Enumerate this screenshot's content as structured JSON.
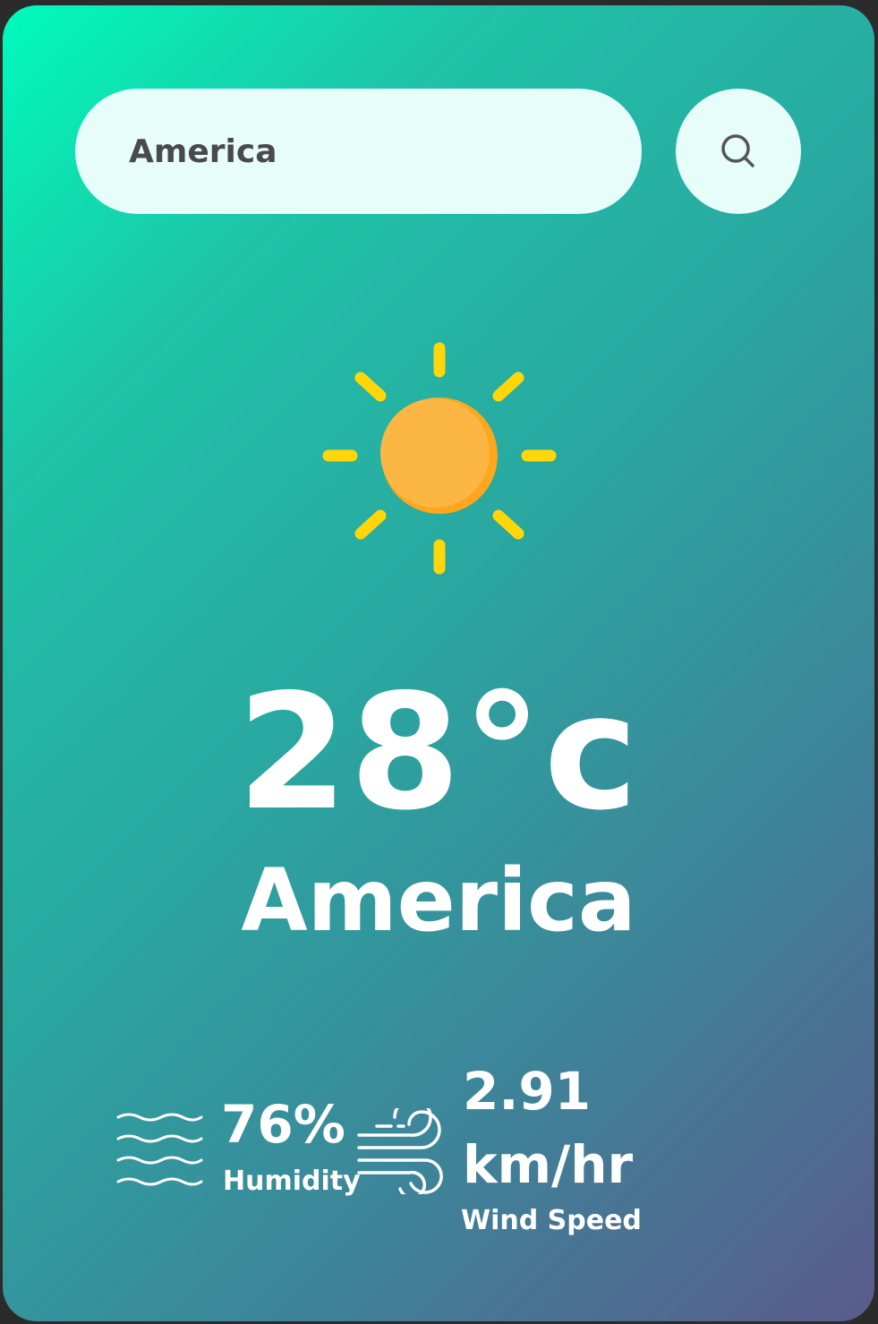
{
  "search": {
    "value": "America",
    "button_icon": "search-icon"
  },
  "weather": {
    "icon": "sun-icon",
    "temperature": "28°c",
    "city": "America"
  },
  "details": {
    "humidity": {
      "icon": "humidity-waves-icon",
      "value": "76%",
      "label": "Humidity"
    },
    "wind": {
      "icon": "wind-icon",
      "value": "2.91 km/hr",
      "label": "Wind Speed"
    }
  },
  "colors": {
    "gradient_start": "#00fbbb",
    "gradient_end": "#5a5b8c",
    "search_bg": "#e6fdfa",
    "sun_core": "#fbb33f",
    "sun_rays": "#ffd60a",
    "text": "#ffffff"
  }
}
